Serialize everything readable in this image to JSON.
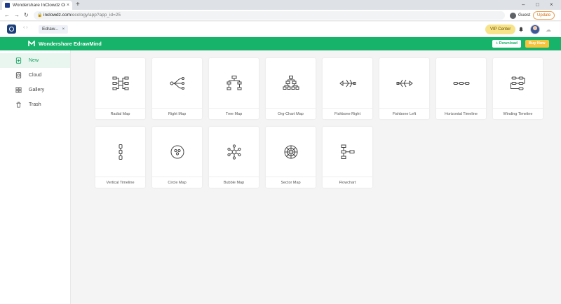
{
  "browser": {
    "tab_title": "Wondershare InClowdz Online",
    "tab_close": "×",
    "new_tab": "+",
    "url_host": "inclowdz.com",
    "url_path": "/ecology/app?app_id=25",
    "profile_label": "Guest",
    "update_label": "Update",
    "window_controls": [
      "–",
      "□",
      "×"
    ]
  },
  "app_bar": {
    "back_forward": "‹ ›",
    "open_tab_label": "Edraw...",
    "open_tab_close": "×",
    "vip_label": "VIP Center"
  },
  "banner": {
    "brand_name": "Wondershare EdrawMind",
    "download_label": "+ Download",
    "buy_label": "Buy Now"
  },
  "sidebar": {
    "items": [
      {
        "label": "New",
        "icon": "new-file-icon"
      },
      {
        "label": "Cloud",
        "icon": "cloud-file-icon"
      },
      {
        "label": "Gallery",
        "icon": "gallery-icon"
      },
      {
        "label": "Trash",
        "icon": "trash-icon"
      }
    ],
    "active_index": 0
  },
  "templates": [
    {
      "label": "Radial Map",
      "icon": "radial-map-icon"
    },
    {
      "label": "Right Map",
      "icon": "right-map-icon"
    },
    {
      "label": "Tree Map",
      "icon": "tree-map-icon"
    },
    {
      "label": "Org-Chart Map",
      "icon": "org-chart-icon"
    },
    {
      "label": "Fishbone Right",
      "icon": "fishbone-right-icon"
    },
    {
      "label": "Fishbone Left",
      "icon": "fishbone-left-icon"
    },
    {
      "label": "Horizontal Timeline",
      "icon": "horizontal-timeline-icon"
    },
    {
      "label": "Winding Timeline",
      "icon": "winding-timeline-icon"
    },
    {
      "label": "Vertical Timeline",
      "icon": "vertical-timeline-icon"
    },
    {
      "label": "Circle Map",
      "icon": "circle-map-icon"
    },
    {
      "label": "Bubble Map",
      "icon": "bubble-map-icon"
    },
    {
      "label": "Sector Map",
      "icon": "sector-map-icon"
    },
    {
      "label": "Flowchart",
      "icon": "flowchart-icon"
    }
  ],
  "colors": {
    "brand_green": "#17b36a",
    "buy_yellow": "#f7c33d",
    "vip_yellow": "#f6e38a"
  }
}
